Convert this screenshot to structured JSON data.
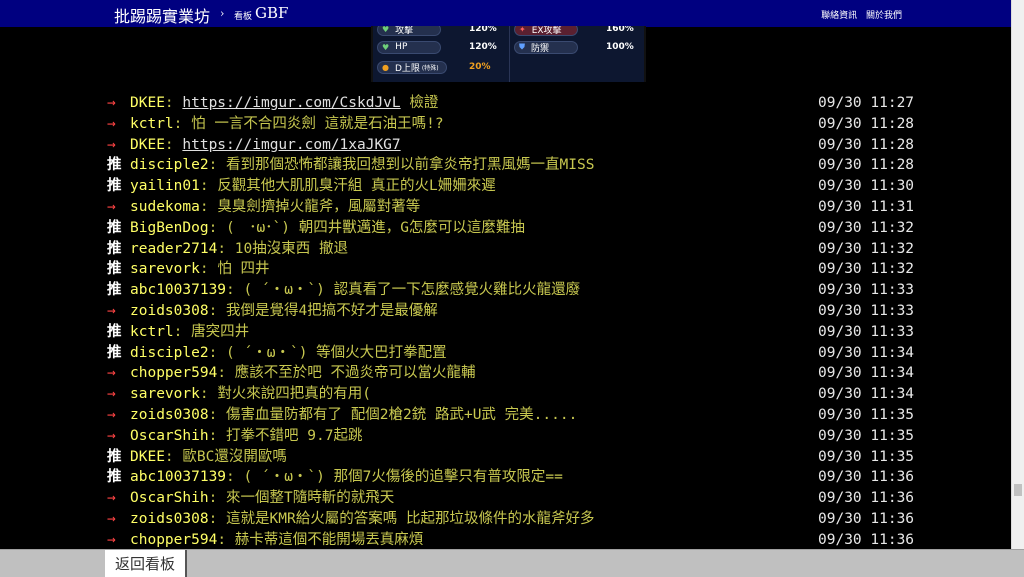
{
  "header": {
    "brand": "批踢踢實業坊",
    "separator": "›",
    "board_label": "看板",
    "board_name": "GBF",
    "links": [
      "聯絡資訊",
      "關於我們"
    ]
  },
  "stat_image": {
    "left_rows": [
      {
        "icon": "heart-icon",
        "label": "攻擊",
        "value": "120%"
      },
      {
        "icon": "heart-icon",
        "label": "HP",
        "value": "120%"
      },
      {
        "icon": "circle-icon",
        "label": "D上限",
        "sub": "(特殊)",
        "value": "20%"
      }
    ],
    "right_rows": [
      {
        "label": "EX攻擊",
        "value": "160%"
      },
      {
        "label": "防禦",
        "value": "100%"
      }
    ]
  },
  "pushes": [
    {
      "tag": "→",
      "user": "DKEE",
      "content": "",
      "link": "https://imgur.com/CskdJvL",
      "suffix": " 檢證",
      "time": "09/30 11:27"
    },
    {
      "tag": "→",
      "user": "kctrl",
      "content": "怕 一言不合四炎劍 這就是石油王嗎!?",
      "time": "09/30 11:28"
    },
    {
      "tag": "→",
      "user": "DKEE",
      "content": "",
      "link": "https://imgur.com/1xaJKG7",
      "suffix": "",
      "time": "09/30 11:28"
    },
    {
      "tag": "推",
      "user": "disciple2",
      "content": "看到那個恐怖都讓我回想到以前拿炎帝打黑風媽一直MISS",
      "time": "09/30 11:28"
    },
    {
      "tag": "推",
      "user": "yailin01",
      "content": "反觀其他大肌肌臭汗組 真正的火L姍姍來遲",
      "time": "09/30 11:30"
    },
    {
      "tag": "→",
      "user": "sudekoma",
      "content": "臭臭劍擠掉火龍斧，風屬對著等",
      "time": "09/30 11:31"
    },
    {
      "tag": "推",
      "user": "BigBenDog",
      "content": "(　･ω･`) 朝四井獸邁進，G怎麼可以這麼難抽",
      "time": "09/30 11:32"
    },
    {
      "tag": "推",
      "user": "reader2714",
      "content": "10抽沒東西 撤退",
      "time": "09/30 11:32"
    },
    {
      "tag": "推",
      "user": "sarevork",
      "content": "怕 四井",
      "time": "09/30 11:32"
    },
    {
      "tag": "推",
      "user": "abc10037139",
      "content": "( ´・ω・`) 認真看了一下怎麼感覺火雞比火龍還廢",
      "time": "09/30 11:33"
    },
    {
      "tag": "→",
      "user": "zoids0308",
      "content": "我倒是覺得4把搞不好才是最優解",
      "time": "09/30 11:33"
    },
    {
      "tag": "推",
      "user": "kctrl",
      "content": "唐突四井",
      "time": "09/30 11:33"
    },
    {
      "tag": "推",
      "user": "disciple2",
      "content": "( ´・ω・`) 等個火大巴打拳配置",
      "time": "09/30 11:34"
    },
    {
      "tag": "→",
      "user": "chopper594",
      "content": "應該不至於吧  不過炎帝可以當火龍輔",
      "time": "09/30 11:34"
    },
    {
      "tag": "→",
      "user": "sarevork",
      "content": "對火來說四把真的有用(",
      "time": "09/30 11:34"
    },
    {
      "tag": "→",
      "user": "zoids0308",
      "content": "傷害血量防都有了 配個2槍2銃 路武+U武  完美.....",
      "time": "09/30 11:35"
    },
    {
      "tag": "→",
      "user": "OscarShih",
      "content": "打拳不錯吧 9.7起跳",
      "time": "09/30 11:35"
    },
    {
      "tag": "推",
      "user": "DKEE",
      "content": "歐BC還沒開歐嗎",
      "time": "09/30 11:35"
    },
    {
      "tag": "推",
      "user": "abc10037139",
      "content": "( ´・ω・`) 那個7火傷後的追擊只有普攻限定==",
      "time": "09/30 11:36"
    },
    {
      "tag": "→",
      "user": "OscarShih",
      "content": "來一個整T隨時斬的就飛天",
      "time": "09/30 11:36"
    },
    {
      "tag": "→",
      "user": "zoids0308",
      "content": "這就是KMR給火屬的答案嗎 比起那垃圾條件的水龍斧好多",
      "time": "09/30 11:36"
    },
    {
      "tag": "→",
      "user": "chopper594",
      "content": "赫卡蒂這個不能開場丟真麻煩",
      "time": "09/30 11:36"
    }
  ],
  "footer": {
    "back_label": "返回看板"
  }
}
